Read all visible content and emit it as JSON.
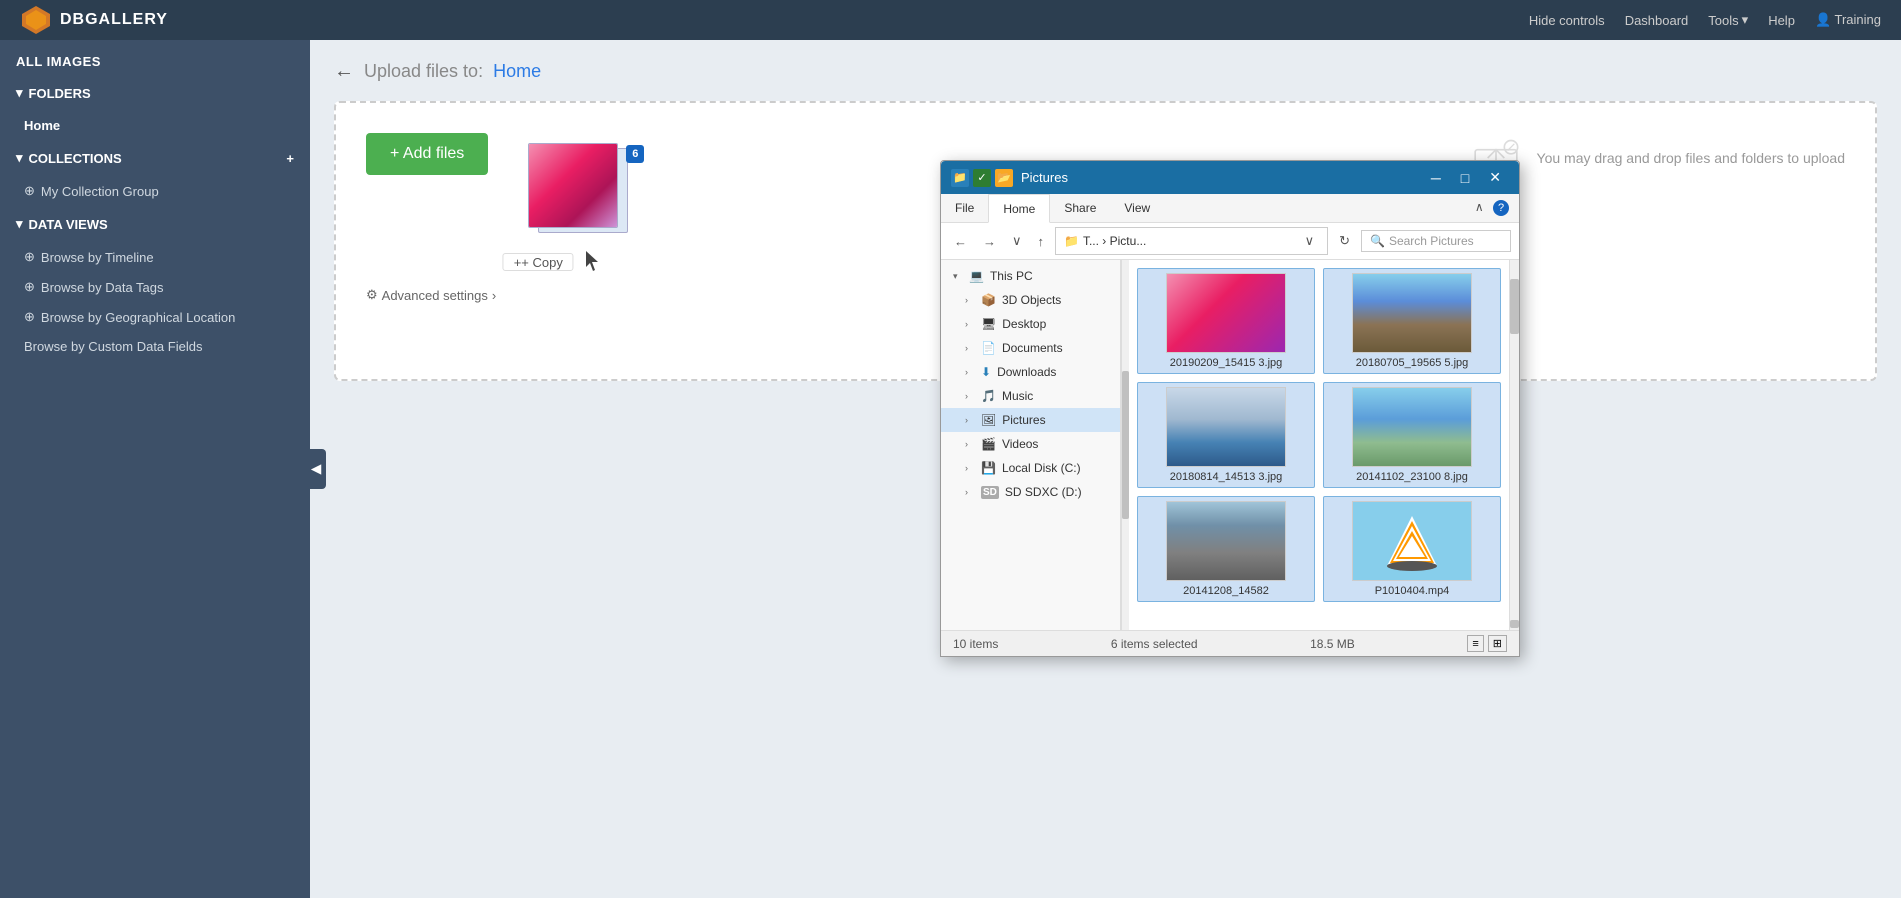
{
  "app": {
    "logo_text": "DBGALLERY",
    "nav_items": [
      "Hide controls",
      "Dashboard",
      "Tools",
      "Help",
      "Training"
    ]
  },
  "sidebar": {
    "all_images_label": "ALL IMAGES",
    "folders_section": "FOLDERS",
    "folders_home": "Home",
    "collections_section": "COLLECTIONS",
    "collections_add_icon": "+",
    "collections_item": "My Collection Group",
    "data_views_section": "DATA VIEWS",
    "data_views_items": [
      "Browse by Timeline",
      "Browse by Data Tags",
      "Browse by Geographical Location",
      "Browse by Custom Data Fields"
    ]
  },
  "upload": {
    "back_label": "←",
    "title_prefix": "Upload files to:",
    "destination": "Home",
    "add_files_label": "+ Add files",
    "drag_drop_label": "You may drag and drop files and folders to upload",
    "advanced_settings_label": "Advanced settings",
    "advanced_settings_arrow": "›",
    "copy_label": "+ Copy",
    "file_count_badge": "6"
  },
  "file_explorer": {
    "title": "Pictures",
    "ribbon_tabs": [
      "File",
      "Home",
      "Share",
      "View"
    ],
    "active_tab": "Home",
    "address_path": "T... › Pictu...",
    "search_placeholder": "Search Pictures",
    "nav_back": "←",
    "nav_forward": "→",
    "nav_dropdown": "∨",
    "nav_up": "↑",
    "sidebar_items": [
      {
        "label": "This PC",
        "expanded": true,
        "icon": "💻",
        "indent": 0
      },
      {
        "label": "3D Objects",
        "expanded": false,
        "icon": "📦",
        "indent": 1
      },
      {
        "label": "Desktop",
        "expanded": false,
        "icon": "🖥",
        "indent": 1
      },
      {
        "label": "Documents",
        "expanded": false,
        "icon": "📄",
        "indent": 1
      },
      {
        "label": "Downloads",
        "expanded": false,
        "icon": "⬇",
        "indent": 1
      },
      {
        "label": "Music",
        "expanded": false,
        "icon": "🎵",
        "indent": 1
      },
      {
        "label": "Pictures",
        "expanded": true,
        "icon": "🖼",
        "indent": 1,
        "selected": true
      },
      {
        "label": "Videos",
        "expanded": false,
        "icon": "🎬",
        "indent": 1
      },
      {
        "label": "Local Disk (C:)",
        "expanded": false,
        "icon": "💾",
        "indent": 1
      },
      {
        "label": "SD SDXC (D:)",
        "expanded": false,
        "icon": "SD",
        "indent": 1
      }
    ],
    "files": [
      {
        "name": "20190209_15415\n3.jpg",
        "thumb": "flowers",
        "selected": true
      },
      {
        "name": "20180705_19565\n5.jpg",
        "thumb": "city",
        "selected": true
      },
      {
        "name": "20180814_14513\n3.jpg",
        "thumb": "river",
        "selected": true
      },
      {
        "name": "20141102_23100\n8.jpg",
        "thumb": "boats",
        "selected": true
      },
      {
        "name": "20141208_14582",
        "thumb": "building",
        "selected": true
      },
      {
        "name": "P1010404.mp4",
        "thumb": "vlc",
        "selected": true
      }
    ],
    "status_items_count": "10 items",
    "status_selected": "6 items selected",
    "status_size": "18.5 MB"
  }
}
